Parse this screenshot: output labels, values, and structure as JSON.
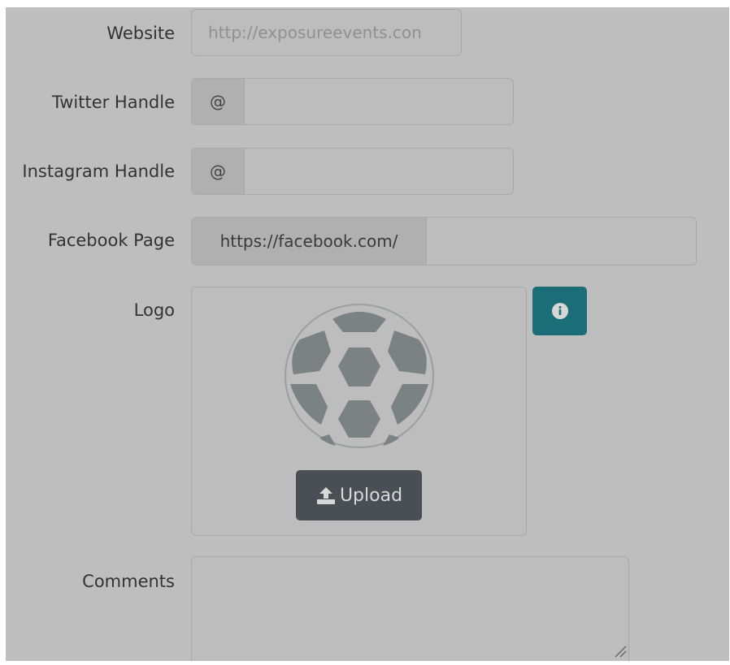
{
  "form": {
    "website": {
      "label": "Website",
      "value": "http://exposureevents.con"
    },
    "twitter": {
      "label": "Twitter Handle",
      "prefix": "@",
      "value": ""
    },
    "instagram": {
      "label": "Instagram Handle",
      "prefix": "@",
      "value": ""
    },
    "facebook": {
      "label": "Facebook Page",
      "prefix": "https://facebook.com/",
      "value": ""
    },
    "logo": {
      "label": "Logo",
      "upload_label": "Upload",
      "image_icon": "soccer-ball-icon",
      "info_icon": "info-icon"
    },
    "comments": {
      "label": "Comments",
      "value": ""
    }
  },
  "colors": {
    "overlay": "#bebebe",
    "info_button": "#1b6d78",
    "upload_button": "#4a4f55"
  }
}
